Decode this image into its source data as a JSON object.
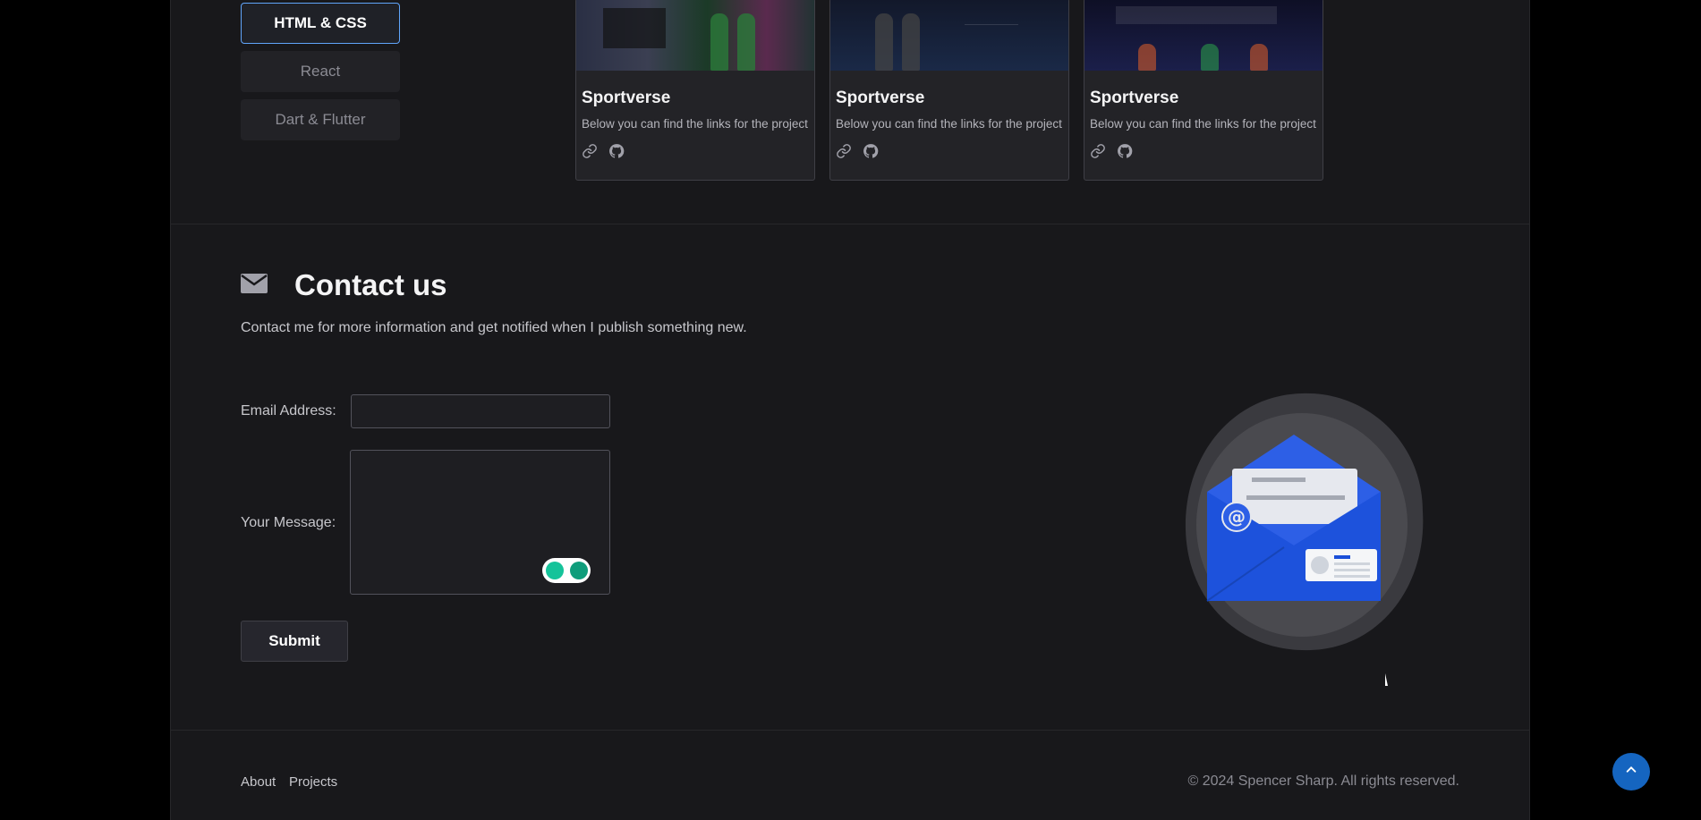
{
  "filters": [
    {
      "label": "HTML & CSS",
      "active": true
    },
    {
      "label": "React",
      "active": false
    },
    {
      "label": "Dart & Flutter",
      "active": false
    }
  ],
  "projects": [
    {
      "title": "Sportverse",
      "description": "Below you can find the links for the project",
      "icons": [
        "link-icon",
        "github-icon"
      ]
    },
    {
      "title": "Sportverse",
      "description": "Below you can find the links for the project",
      "icons": [
        "link-icon",
        "github-icon"
      ]
    },
    {
      "title": "Sportverse",
      "description": "Below you can find the links for the project",
      "icons": [
        "link-icon",
        "github-icon"
      ]
    }
  ],
  "contact": {
    "icon": "envelope-icon",
    "title": "Contact us",
    "subtitle": "Contact me for more information and get notified when I publish something new.",
    "email_label": "Email Address:",
    "email_value": "",
    "message_label": "Your Message:",
    "message_value": "",
    "submit_label": "Submit"
  },
  "footer": {
    "links": [
      "About",
      "Projects"
    ],
    "copyright": "© 2024 Spencer Sharp. All rights reserved."
  },
  "colors": {
    "accent": "#60a5fa",
    "background": "#18181b",
    "scroll_button": "#1565c0"
  }
}
